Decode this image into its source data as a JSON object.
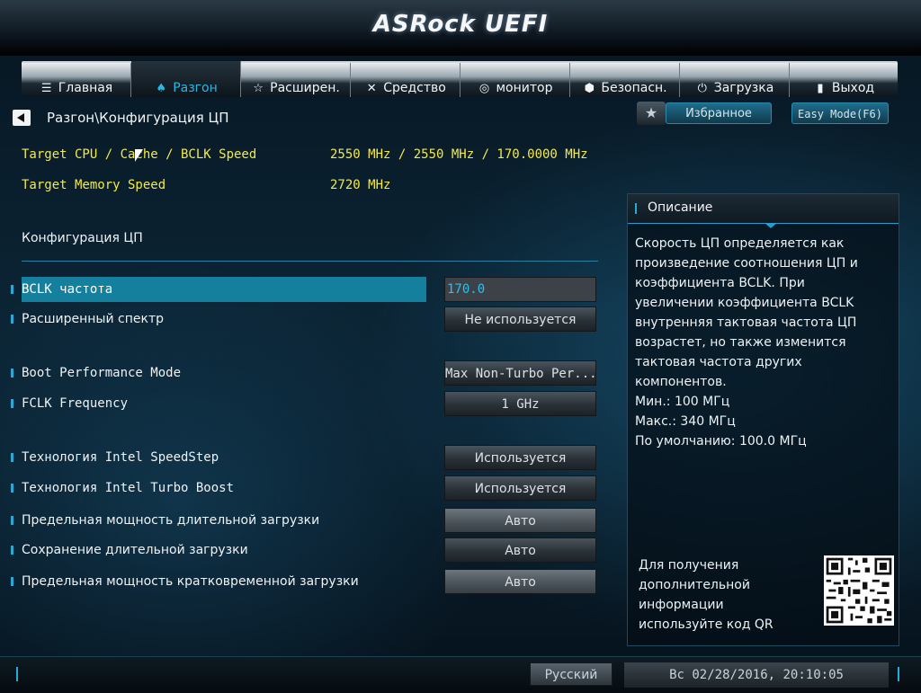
{
  "brand": "ASRock UEFI",
  "nav": {
    "tabs": [
      {
        "label": "Главная",
        "icon": "list-icon",
        "glyph": "☰"
      },
      {
        "label": "Разгон",
        "icon": "flame-icon",
        "glyph": "♠",
        "active": true
      },
      {
        "label": "Расширен.",
        "icon": "star-outline-icon",
        "glyph": "☆"
      },
      {
        "label": "Средство",
        "icon": "tools-icon",
        "glyph": "✕"
      },
      {
        "label": "монитор",
        "icon": "monitor-icon",
        "glyph": "◎"
      },
      {
        "label": "Безопасн.",
        "icon": "shield-icon",
        "glyph": "⬢"
      },
      {
        "label": "Загрузка",
        "icon": "power-icon",
        "glyph": "⏻"
      },
      {
        "label": "Выход",
        "icon": "exit-icon",
        "glyph": "▮"
      }
    ]
  },
  "breadcrumb": "Разгон\\Конфигурация ЦП",
  "favorites": {
    "label": "Избранное",
    "star": "★"
  },
  "easy_mode": {
    "label": "Easy Mode(F6)"
  },
  "info": [
    {
      "label": "Target CPU / Cache / BCLK Speed",
      "value": "2550 MHz / 2550 MHz / 170.0000 MHz"
    },
    {
      "label": "Target Memory Speed",
      "value": "2720 MHz"
    }
  ],
  "section_title": "Конфигурация ЦП",
  "settings": {
    "bclk": {
      "label": "BCLK частота",
      "value": "170.0"
    },
    "spread": {
      "label": "Расширенный спектр",
      "value": "Не используется"
    },
    "boot_perf": {
      "label": "Boot Performance Mode",
      "value": "Max Non-Turbo Per..."
    },
    "fclk": {
      "label": "FCLK Frequency",
      "value": "1 GHz"
    },
    "speedstep": {
      "label": "Технология Intel SpeedStep",
      "value": "Используется"
    },
    "turbo": {
      "label": "Технология Intel Turbo Boost",
      "value": "Используется"
    },
    "long_power": {
      "label": "Предельная мощность длительной загрузки",
      "value": "Авто"
    },
    "long_keep": {
      "label": "Сохранение длительной загрузки",
      "value": "Авто"
    },
    "short_power": {
      "label": "Предельная мощность кратковременной загрузки",
      "value": "Авто"
    }
  },
  "description": {
    "title": "Описание",
    "lines": [
      "Скорость ЦП определяется как",
      "произведение соотношения ЦП и",
      "коэффициента BCLK. При",
      "увеличении коэффициента BCLK",
      "внутренняя тактовая частота ЦП",
      "возрастет, но также изменится",
      "тактовая частота других",
      "компонентов.",
      "Мин.: 100 МГц",
      "Макс.: 340 МГц",
      "По умолчанию: 100.0 МГц"
    ],
    "qr_lines": [
      "Для получения",
      "дополнительной",
      "информации",
      "используйте код QR"
    ]
  },
  "footer": {
    "language": "Русский",
    "datetime": "Вс 02/28/2016, 20:10:05"
  }
}
